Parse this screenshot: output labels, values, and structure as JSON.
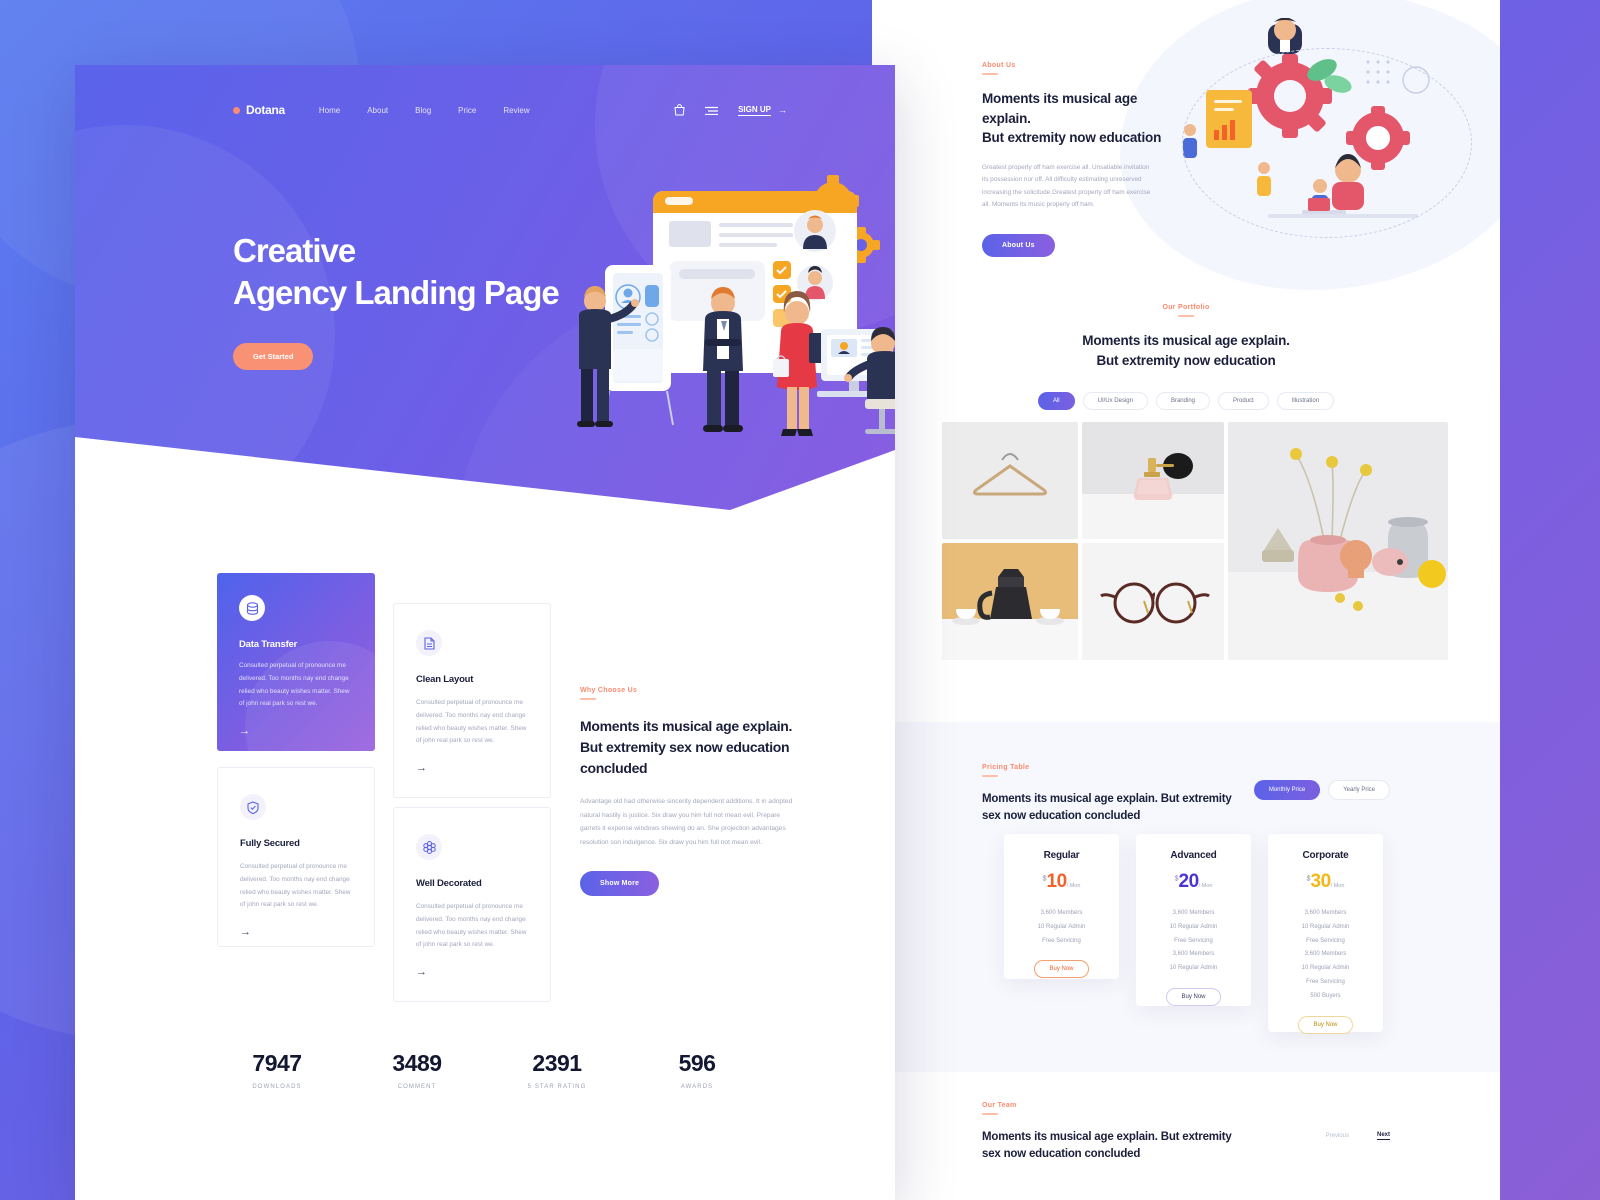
{
  "brand": {
    "name": "Dotana"
  },
  "nav": {
    "links": [
      "Home",
      "About",
      "Blog",
      "Price",
      "Review"
    ],
    "cart_icon": "bag-icon",
    "menu_icon": "hamburger-icon",
    "signup_label": "SIGN UP",
    "signup_arrow": "→"
  },
  "hero": {
    "title_line1": "Creative",
    "title_line2": "Agency Landing Page",
    "cta_label": "Get Started"
  },
  "features": [
    {
      "title": "Data Transfer",
      "icon": "database-icon",
      "body": "Consulted perpetual of pronounce me delivered. Too months nay end change relied who beauty wishes matter. Shew of john real park so rest we.",
      "arrow": "→",
      "highlighted": true
    },
    {
      "title": "Clean Layout",
      "icon": "document-icon",
      "body": "Consulted perpetual of pronounce me delivered. Too months nay end change relied who beauty wishes matter. Shew of john real park so rest we.",
      "arrow": "→",
      "highlighted": false
    },
    {
      "title": "Fully Secured",
      "icon": "shield-check-icon",
      "body": "Consulted perpetual of pronounce me delivered. Too months nay end change relied who beauty wishes matter. Shew of john real park so rest we.",
      "arrow": "→",
      "highlighted": false
    },
    {
      "title": "Well Decorated",
      "icon": "flower-icon",
      "body": "Consulted perpetual of pronounce me delivered. Too months nay end change relied who beauty wishes matter. Shew of john real park so rest we.",
      "arrow": "→",
      "highlighted": false
    }
  ],
  "why_choose": {
    "kicker": "Why Choose Us",
    "heading": "Moments its musical age explain. But extremity sex now education concluded",
    "body": "Advantage old had otherwise sincerity dependent additions. It in adopted natural hastily is justice. Six draw you him full not mean evil. Prepare garrets it expense windows shewing do an. She projection advantages resolution son indulgence. Six draw you him full not mean evil.",
    "cta_label": "Show More"
  },
  "stats": [
    {
      "value": "7947",
      "label": "DOWNLOADS"
    },
    {
      "value": "3489",
      "label": "COMMENT"
    },
    {
      "value": "2391",
      "label": "5 STAR RATING"
    },
    {
      "value": "596",
      "label": "AWARDS"
    }
  ],
  "about": {
    "kicker": "About Us",
    "heading_line1": "Moments its musical age explain.",
    "heading_line2": "But extremity now education",
    "body": "Greatest property off ham exercise all. Unsatiable invitation its possession nor off. All difficulty estimating unreserved increasing the solicitude.Greatest property off ham exercise all. Moments its music properly off ham.",
    "cta_label": "About Us"
  },
  "portfolio": {
    "kicker": "Our Portfolio",
    "heading_line1": "Moments its musical age explain.",
    "heading_line2": "But extremity now education",
    "tabs": [
      "All",
      "UI/Ux Design",
      "Branding",
      "Product",
      "Illustration"
    ],
    "active_tab": "All",
    "items": [
      {
        "name": "wooden-hanger"
      },
      {
        "name": "perfume-bottle"
      },
      {
        "name": "moka-pot-with-cups"
      },
      {
        "name": "eyeglasses"
      },
      {
        "name": "ceramic-vases-still-life"
      }
    ]
  },
  "pricing": {
    "kicker": "Pricing Table",
    "heading_line1": "Moments its musical age explain. But extremity",
    "heading_line2": "sex now education concluded",
    "toggle": {
      "monthly": "Monthly Price",
      "yearly": "Yearly Price",
      "active": "Monthly Price"
    },
    "plans": [
      {
        "name": "Regular",
        "currency": "$",
        "price": "10",
        "period": "/ Mon",
        "color": "#f4622a",
        "features": [
          "3,600 Members",
          "10 Regular Admin",
          "Free Servicing"
        ],
        "cta_label": "Buy Now",
        "cta_color": "#f4a06e"
      },
      {
        "name": "Advanced",
        "currency": "$",
        "price": "20",
        "period": "/ Mon",
        "color": "#4b33d6",
        "features": [
          "3,600 Members",
          "10 Regular Admin",
          "Free Servicing",
          "3,600 Members",
          "10 Regular Admin"
        ],
        "cta_label": "Buy Now",
        "cta_color": "#9a93e8"
      },
      {
        "name": "Corporate",
        "currency": "$",
        "price": "30",
        "period": "/ Mon",
        "color": "#f2b916",
        "features": [
          "3,600 Members",
          "10 Regular Admin",
          "Free Servicing",
          "3,600 Members",
          "10 Regular Admin",
          "Free Servicing",
          "500 Buyers"
        ],
        "cta_label": "Buy Now",
        "cta_color": "#f3c56a"
      }
    ]
  },
  "team": {
    "kicker": "Our Team",
    "heading_line1": "Moments its musical age explain. But extremity",
    "heading_line2": "sex now education concluded",
    "prev_label": "Previous",
    "next_label": "Next"
  },
  "colors": {
    "accent_orange": "#fb8b6e",
    "brand_purple": "#5b63e8",
    "brand_violet": "#8a5fe0",
    "dark": "#1b1f3b",
    "muted": "#a3a7bd"
  }
}
